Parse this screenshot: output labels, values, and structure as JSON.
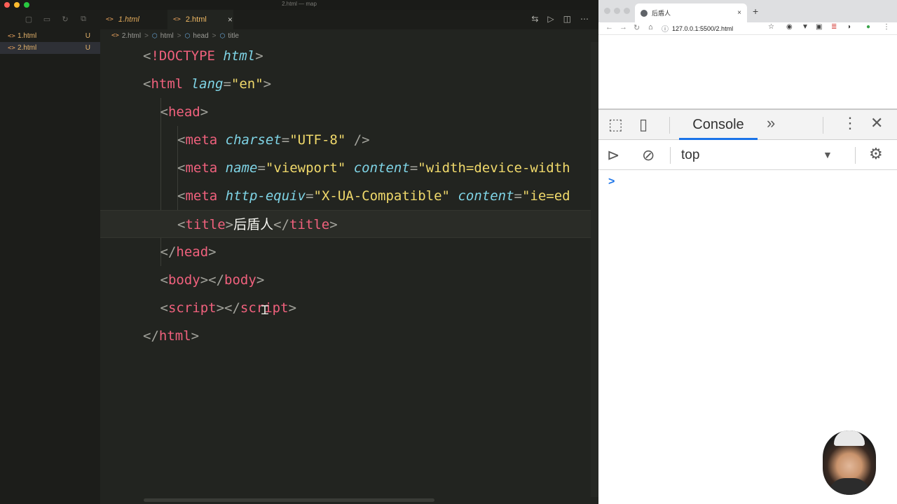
{
  "window": {
    "title": "2.html — map"
  },
  "sidebar": {
    "files": [
      {
        "icon": "<>",
        "name": "1.html",
        "status": "U"
      },
      {
        "icon": "<>",
        "name": "2.html",
        "status": "U"
      }
    ]
  },
  "tabs": [
    {
      "icon": "<>",
      "label": "1.html"
    },
    {
      "icon": "<>",
      "label": "2.html",
      "close": "×"
    }
  ],
  "breadcrumb": {
    "items": [
      "2.html",
      "html",
      "head",
      "title"
    ],
    "separator": ">"
  },
  "code_lines": [
    {
      "indent": "",
      "parts": [
        [
          "p",
          "<"
        ],
        [
          "dt",
          "!DOCTYPE"
        ],
        [
          "tx",
          " "
        ],
        [
          "at",
          "html"
        ],
        [
          "p",
          ">"
        ]
      ]
    },
    {
      "indent": "",
      "parts": [
        [
          "p",
          "<"
        ],
        [
          "tg",
          "html"
        ],
        [
          "tx",
          " "
        ],
        [
          "at",
          "lang"
        ],
        [
          "p",
          "="
        ],
        [
          "st",
          "\"en\""
        ],
        [
          "p",
          ">"
        ]
      ]
    },
    {
      "indent": "  ",
      "parts": [
        [
          "p",
          "<"
        ],
        [
          "tg",
          "head"
        ],
        [
          "p",
          ">"
        ]
      ]
    },
    {
      "indent": "    ",
      "parts": [
        [
          "p",
          "<"
        ],
        [
          "tg",
          "meta"
        ],
        [
          "tx",
          " "
        ],
        [
          "at",
          "charset"
        ],
        [
          "p",
          "="
        ],
        [
          "st",
          "\"UTF-8\""
        ],
        [
          "tx",
          " "
        ],
        [
          "p",
          "/>"
        ]
      ]
    },
    {
      "indent": "    ",
      "parts": [
        [
          "p",
          "<"
        ],
        [
          "tg",
          "meta"
        ],
        [
          "tx",
          " "
        ],
        [
          "at",
          "name"
        ],
        [
          "p",
          "="
        ],
        [
          "st",
          "\"viewport\""
        ],
        [
          "tx",
          " "
        ],
        [
          "at",
          "content"
        ],
        [
          "p",
          "="
        ],
        [
          "st",
          "\"width=device-width"
        ]
      ]
    },
    {
      "indent": "    ",
      "parts": [
        [
          "p",
          "<"
        ],
        [
          "tg",
          "meta"
        ],
        [
          "tx",
          " "
        ],
        [
          "at",
          "http-equiv"
        ],
        [
          "p",
          "="
        ],
        [
          "st",
          "\"X-UA-Compatible\""
        ],
        [
          "tx",
          " "
        ],
        [
          "at",
          "content"
        ],
        [
          "p",
          "="
        ],
        [
          "st",
          "\"ie=ed"
        ]
      ]
    },
    {
      "indent": "    ",
      "parts": [
        [
          "p",
          "<"
        ],
        [
          "tg",
          "title"
        ],
        [
          "p",
          ">"
        ],
        [
          "tx",
          "后盾人"
        ],
        [
          "p",
          "</"
        ],
        [
          "tg",
          "title"
        ],
        [
          "p",
          ">"
        ]
      ]
    },
    {
      "indent": "  ",
      "parts": [
        [
          "p",
          "</"
        ],
        [
          "tg",
          "head"
        ],
        [
          "p",
          ">"
        ]
      ]
    },
    {
      "indent": "  ",
      "parts": [
        [
          "p",
          "<"
        ],
        [
          "tg",
          "body"
        ],
        [
          "p",
          "></"
        ],
        [
          "tg",
          "body"
        ],
        [
          "p",
          ">"
        ]
      ]
    },
    {
      "indent": "  ",
      "parts": [
        [
          "p",
          "<"
        ],
        [
          "tg",
          "script"
        ],
        [
          "p",
          "></"
        ],
        [
          "tg",
          "script"
        ],
        [
          "p",
          ">"
        ]
      ]
    },
    {
      "indent": "",
      "parts": [
        [
          "p",
          "</"
        ],
        [
          "tg",
          "html"
        ],
        [
          "p",
          ">"
        ]
      ]
    }
  ],
  "browser": {
    "tab_title": "后盾人",
    "tab_close": "×",
    "new_tab": "+",
    "url": "127.0.0.1:5500/2.html"
  },
  "devtools": {
    "active_tab": "Console",
    "more_tabs": "»",
    "context": "top",
    "prompt": ">"
  },
  "colors": {
    "editor_bg": "#222420",
    "tag": "#f0617d",
    "attr": "#7fd4e6",
    "string": "#f0d96b",
    "accent": "#1a73e8"
  }
}
